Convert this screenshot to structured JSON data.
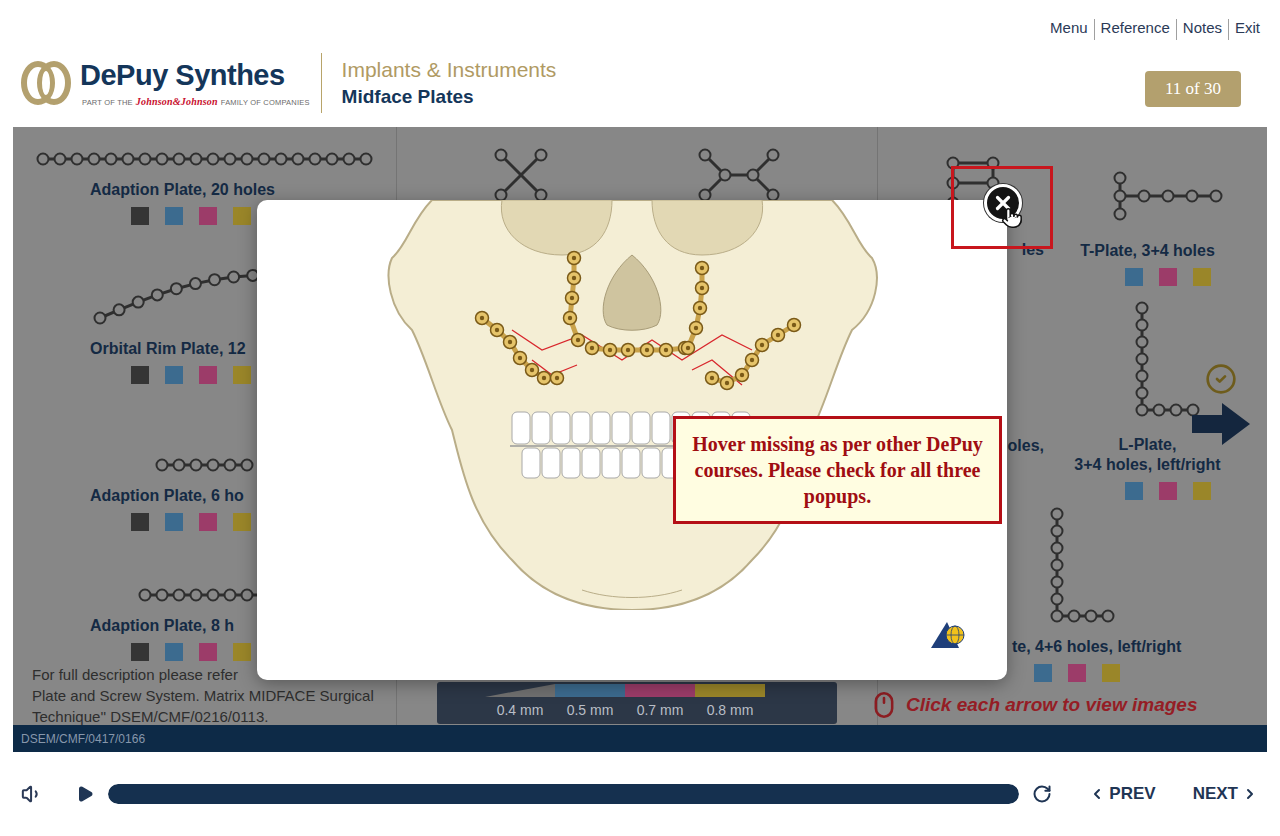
{
  "header": {
    "nav": [
      "Menu",
      "Reference",
      "Notes",
      "Exit"
    ],
    "brand": "DePuy Synthes",
    "tagline": {
      "prefix": "PART OF THE",
      "company": "Johnson&Johnson",
      "suffix": "FAMILY OF COMPANIES"
    },
    "course": "Implants & Instruments",
    "module": "Midface Plates",
    "page": "11 of 30"
  },
  "catalog": {
    "left": [
      {
        "lines": [
          "Adaption Plate, 20 holes"
        ],
        "kind": "straight",
        "holes": [
          20
        ],
        "swatches": [
          "#353535",
          "#3c6b8f",
          "#9c3c69",
          "#9a8629"
        ]
      },
      {
        "lines": [
          "Orbital Rim Plate, 12"
        ],
        "kind": "curved",
        "holes": [
          12
        ],
        "swatches": [
          "#353535",
          "#3c6b8f",
          "#9c3c69",
          "#9a8629"
        ]
      },
      {
        "lines": [
          "Adaption Plate, 6 ho"
        ],
        "kind": "straight",
        "holes": [
          6
        ],
        "swatches": [
          "#353535",
          "#3c6b8f",
          "#9c3c69",
          "#9a8629"
        ]
      },
      {
        "lines": [
          "Adaption Plate, 8 h"
        ],
        "kind": "straight",
        "holes": [
          8
        ],
        "swatches": [
          "#353535",
          "#3c6b8f",
          "#9c3c69",
          "#9a8629"
        ]
      }
    ],
    "middle": [
      {
        "lines": [],
        "kind": "x",
        "holes": [
          4
        ],
        "swatches": []
      },
      {
        "lines": [],
        "kind": "bowtie",
        "holes": [
          6
        ],
        "swatches": []
      }
    ],
    "right_narrow": [
      {
        "lines": [
          "les"
        ],
        "kind": "ladder",
        "holes": [
          3,
          2
        ],
        "swatches": []
      },
      {
        "lines": [
          "oles,"
        ],
        "kind": "none",
        "holes": [],
        "swatches": []
      }
    ],
    "right_main": [
      {
        "lines": [
          "T-Plate, 3+4 holes"
        ],
        "kind": "t",
        "holes": [
          3,
          4
        ],
        "swatches": [
          "#3c6b8f",
          "#9c3c69",
          "#9a8629"
        ]
      },
      {
        "lines": [
          "L-Plate,",
          "3+4 holes, left/right"
        ],
        "kind": "l",
        "holes": [
          7,
          3
        ],
        "swatches": [
          "#3c6b8f",
          "#9c3c69",
          "#9a8629"
        ]
      }
    ],
    "right_bottom": {
      "lines": [
        "te, 4+6 holes, left/right"
      ],
      "kind": "l",
      "holes": [
        7,
        3
      ],
      "swatches": [
        "#3c6b8f",
        "#9c3c69",
        "#9a8629"
      ]
    }
  },
  "legend": [
    {
      "label": "0.4 mm",
      "color": "#707070"
    },
    {
      "label": "0.5 mm",
      "color": "#3c6b8f"
    },
    {
      "label": "0.7 mm",
      "color": "#9c3c69"
    },
    {
      "label": "0.8 mm",
      "color": "#9a8629"
    }
  ],
  "description": [
    "For full description please refer",
    "Plate and Screw System. Matrix MIDFACE Surgical",
    "Technique'' DSEM/CMF/0216/0113."
  ],
  "hint": "Click each arrow to view images",
  "arrow": {
    "visited": true
  },
  "popup": {
    "note": "Hover missing as per other DePuy courses. Please check for all three popups.",
    "close_highlighted": true
  },
  "footer": {
    "code": "DSEM/CMF/0417/0166"
  },
  "player": {
    "muted": false,
    "playing": false,
    "level": 1,
    "prev": "PREV",
    "next": "NEXT"
  }
}
